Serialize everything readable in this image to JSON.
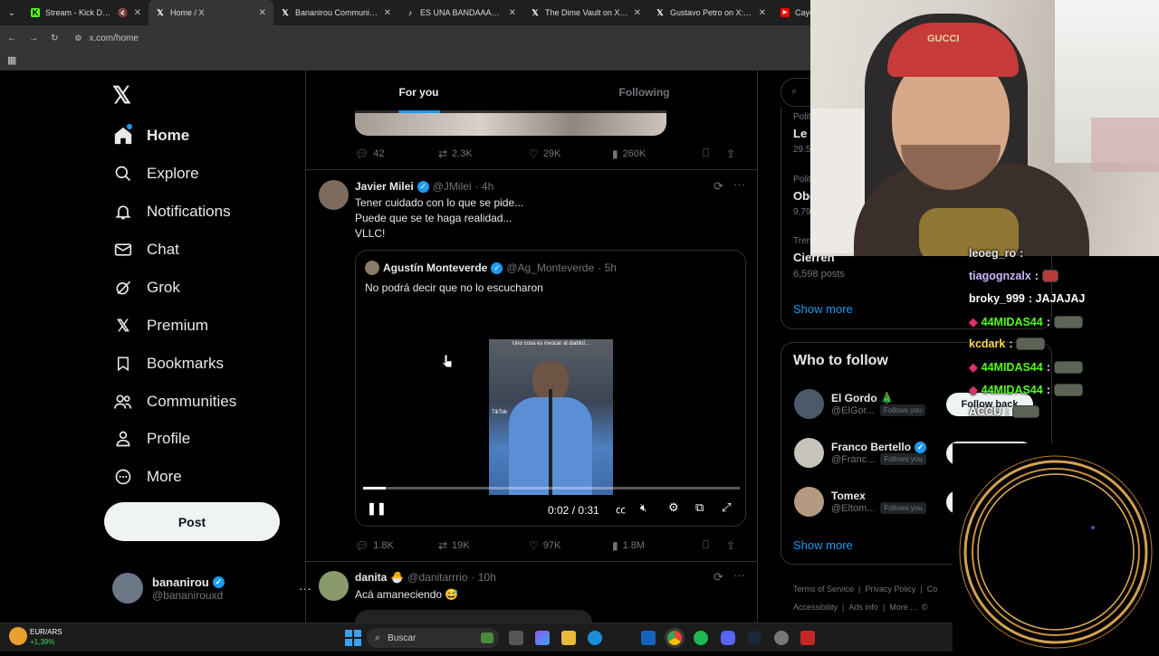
{
  "browser": {
    "tabs": [
      {
        "label": "Stream - Kick Dashbo",
        "favicon": "kick-icon",
        "active": false
      },
      {
        "label": "Home / X",
        "favicon": "x-icon",
        "active": true
      },
      {
        "label": "Bananirou Community / X",
        "favicon": "x-icon",
        "active": false
      },
      {
        "label": "ES UNA BANDAAAA #par",
        "favicon": "tiktok-icon",
        "active": false
      },
      {
        "label": "The Dime Vault on X: \"He",
        "favicon": "x-icon",
        "active": false
      },
      {
        "label": "Gustavo Petro on X: \"Bala",
        "favicon": "x-icon",
        "active": false
      },
      {
        "label": "Cayo",
        "favicon": "youtube-icon",
        "active": false
      }
    ],
    "url": "x.com/home"
  },
  "nav": {
    "items": [
      {
        "label": "Home",
        "icon": "home-icon"
      },
      {
        "label": "Explore",
        "icon": "search-icon"
      },
      {
        "label": "Notifications",
        "icon": "bell-icon"
      },
      {
        "label": "Chat",
        "icon": "mail-icon"
      },
      {
        "label": "Grok",
        "icon": "grok-icon"
      },
      {
        "label": "Premium",
        "icon": "x-logo-icon"
      },
      {
        "label": "Bookmarks",
        "icon": "bookmark-icon"
      },
      {
        "label": "Communities",
        "icon": "people-icon"
      },
      {
        "label": "Profile",
        "icon": "person-icon"
      },
      {
        "label": "More",
        "icon": "more-circle-icon"
      }
    ],
    "post_label": "Post",
    "account": {
      "name": "bananirou",
      "handle": "@bananirouxd"
    }
  },
  "feed": {
    "tabs": [
      {
        "label": "For you"
      },
      {
        "label": "Following"
      }
    ],
    "prev_tweet_stats": {
      "replies": "42",
      "reposts": "2.3K",
      "likes": "29K",
      "views": "260K"
    },
    "tweet": {
      "name": "Javier Milei",
      "handle": "@JMilei",
      "time": "· 4h",
      "text": [
        "Tener cuidado con lo que se pide...",
        "Puede que se te haga realidad...",
        "VLLC!"
      ],
      "quote": {
        "name": "Agustín Monteverde",
        "handle": "@Ag_Monteverde",
        "time": "· 5h",
        "text": "No podrá decir que no lo escucharon",
        "video_caption": "Uno cosa es invocar al diablo!...",
        "video_watermark": "TikTok",
        "time_display": "0:02 / 0:31",
        "progress": 0.06
      },
      "stats": {
        "replies": "1.8K",
        "reposts": "19K",
        "likes": "97K",
        "views": "1.8M"
      }
    },
    "next_tweet": {
      "name": "danita",
      "emoji": "🐣",
      "handle": "@danitarrrio",
      "time": "· 10h",
      "text": "Acá amaneciendo 😅"
    }
  },
  "trends": {
    "items": [
      {
        "category": "Politi",
        "title": "Le",
        "count": "29.5"
      },
      {
        "category": "Politi",
        "title": "Obe",
        "count": "9,79"
      },
      {
        "category": "Tren",
        "title": "Cierren",
        "count": "6,598 posts"
      }
    ],
    "show_more": "Show more"
  },
  "who_to_follow": {
    "title": "Who to follow",
    "users": [
      {
        "name": "El Gordo 🎄",
        "handle": "@ElGor...",
        "badge": "Follows you",
        "verified": false
      },
      {
        "name": "Franco Bertello",
        "handle": "@Franc...",
        "badge": "Follows you",
        "verified": true
      },
      {
        "name": "Tomex",
        "handle": "@Eltom...",
        "badge": "Follows you",
        "verified": false
      }
    ],
    "follow_back": "Follow back",
    "show_more": "Show more"
  },
  "footer_links": [
    "Terms of Service",
    "|",
    "Privacy Policy",
    "|",
    "Co",
    "Accessibility",
    "|",
    "Ads info",
    "|",
    "More ...",
    "©"
  ],
  "chat": {
    "messages": [
      {
        "user": "leoeg_ro",
        "text": ":",
        "color": "#e0e0e0",
        "emote": false
      },
      {
        "user": "tiagognzalx",
        "text": ":",
        "color": "#c9b6ff",
        "emote": true
      },
      {
        "user": "broky_999",
        "text": ": JAJAJAJ",
        "color": "#ffffff",
        "emote": false
      },
      {
        "user": "44MIDAS44",
        "text": ":",
        "color": "#53fc18",
        "emote": true
      },
      {
        "user": "kcdark",
        "text": ":",
        "color": "#ffd54f",
        "emote": true
      },
      {
        "user": "44MIDAS44",
        "text": ":",
        "color": "#53fc18",
        "emote": true
      },
      {
        "user": "44MIDAS44",
        "text": ":",
        "color": "#53fc18",
        "emote": true
      },
      {
        "user": "ACCU",
        "text": ":",
        "color": "#ffffff",
        "emote": true
      }
    ]
  },
  "taskbar": {
    "widget_title": "EUR/ARS",
    "widget_change": "+1,39%",
    "search_placeholder": "Buscar"
  },
  "colors": {
    "accent": "#1d9bf0",
    "kick_green": "#53fc18",
    "ring": "#d4a050"
  }
}
